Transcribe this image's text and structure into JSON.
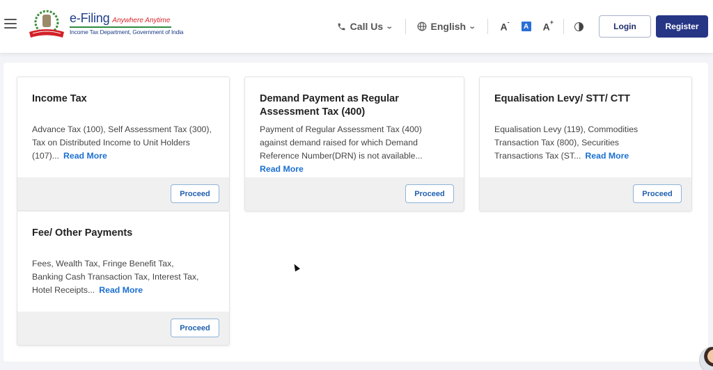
{
  "header": {
    "logo": {
      "title": "e-Filing",
      "tagline": "Anywhere Anytime",
      "subtitle": "Income Tax Department, Government of India"
    },
    "call_us": "Call Us",
    "language": "English",
    "font_decrease": "A",
    "font_default": "A",
    "font_increase": "A",
    "font_decrease_sup": "-",
    "font_increase_sup": "+",
    "login": "Login",
    "register": "Register"
  },
  "colors": {
    "brand_navy": "#263685",
    "link_blue": "#1a6fd1",
    "footer_gray": "#f0f0f0"
  },
  "cards": [
    {
      "title": "Income Tax",
      "description": "Advance Tax (100), Self Assessment Tax (300), Tax on Distributed Income to Unit Holders (107)...",
      "read_more": "Read More",
      "proceed": "Proceed"
    },
    {
      "title": "Demand Payment as Regular Assessment Tax (400)",
      "description": "Payment of Regular Assessment Tax (400) against demand raised for which Demand Reference Number(DRN) is not available...",
      "read_more": "Read More",
      "proceed": "Proceed"
    },
    {
      "title": "Equalisation Levy/ STT/ CTT",
      "description": "Equalisation Levy (119), Commodities Transaction Tax (800), Securities Transactions Tax (ST...",
      "read_more": "Read More",
      "proceed": "Proceed"
    },
    {
      "title": "Fee/ Other Payments",
      "description": "Fees, Wealth Tax, Fringe Benefit Tax, Banking Cash Transaction Tax, Interest Tax, Hotel Receipts...",
      "read_more": "Read More",
      "proceed": "Proceed"
    }
  ]
}
